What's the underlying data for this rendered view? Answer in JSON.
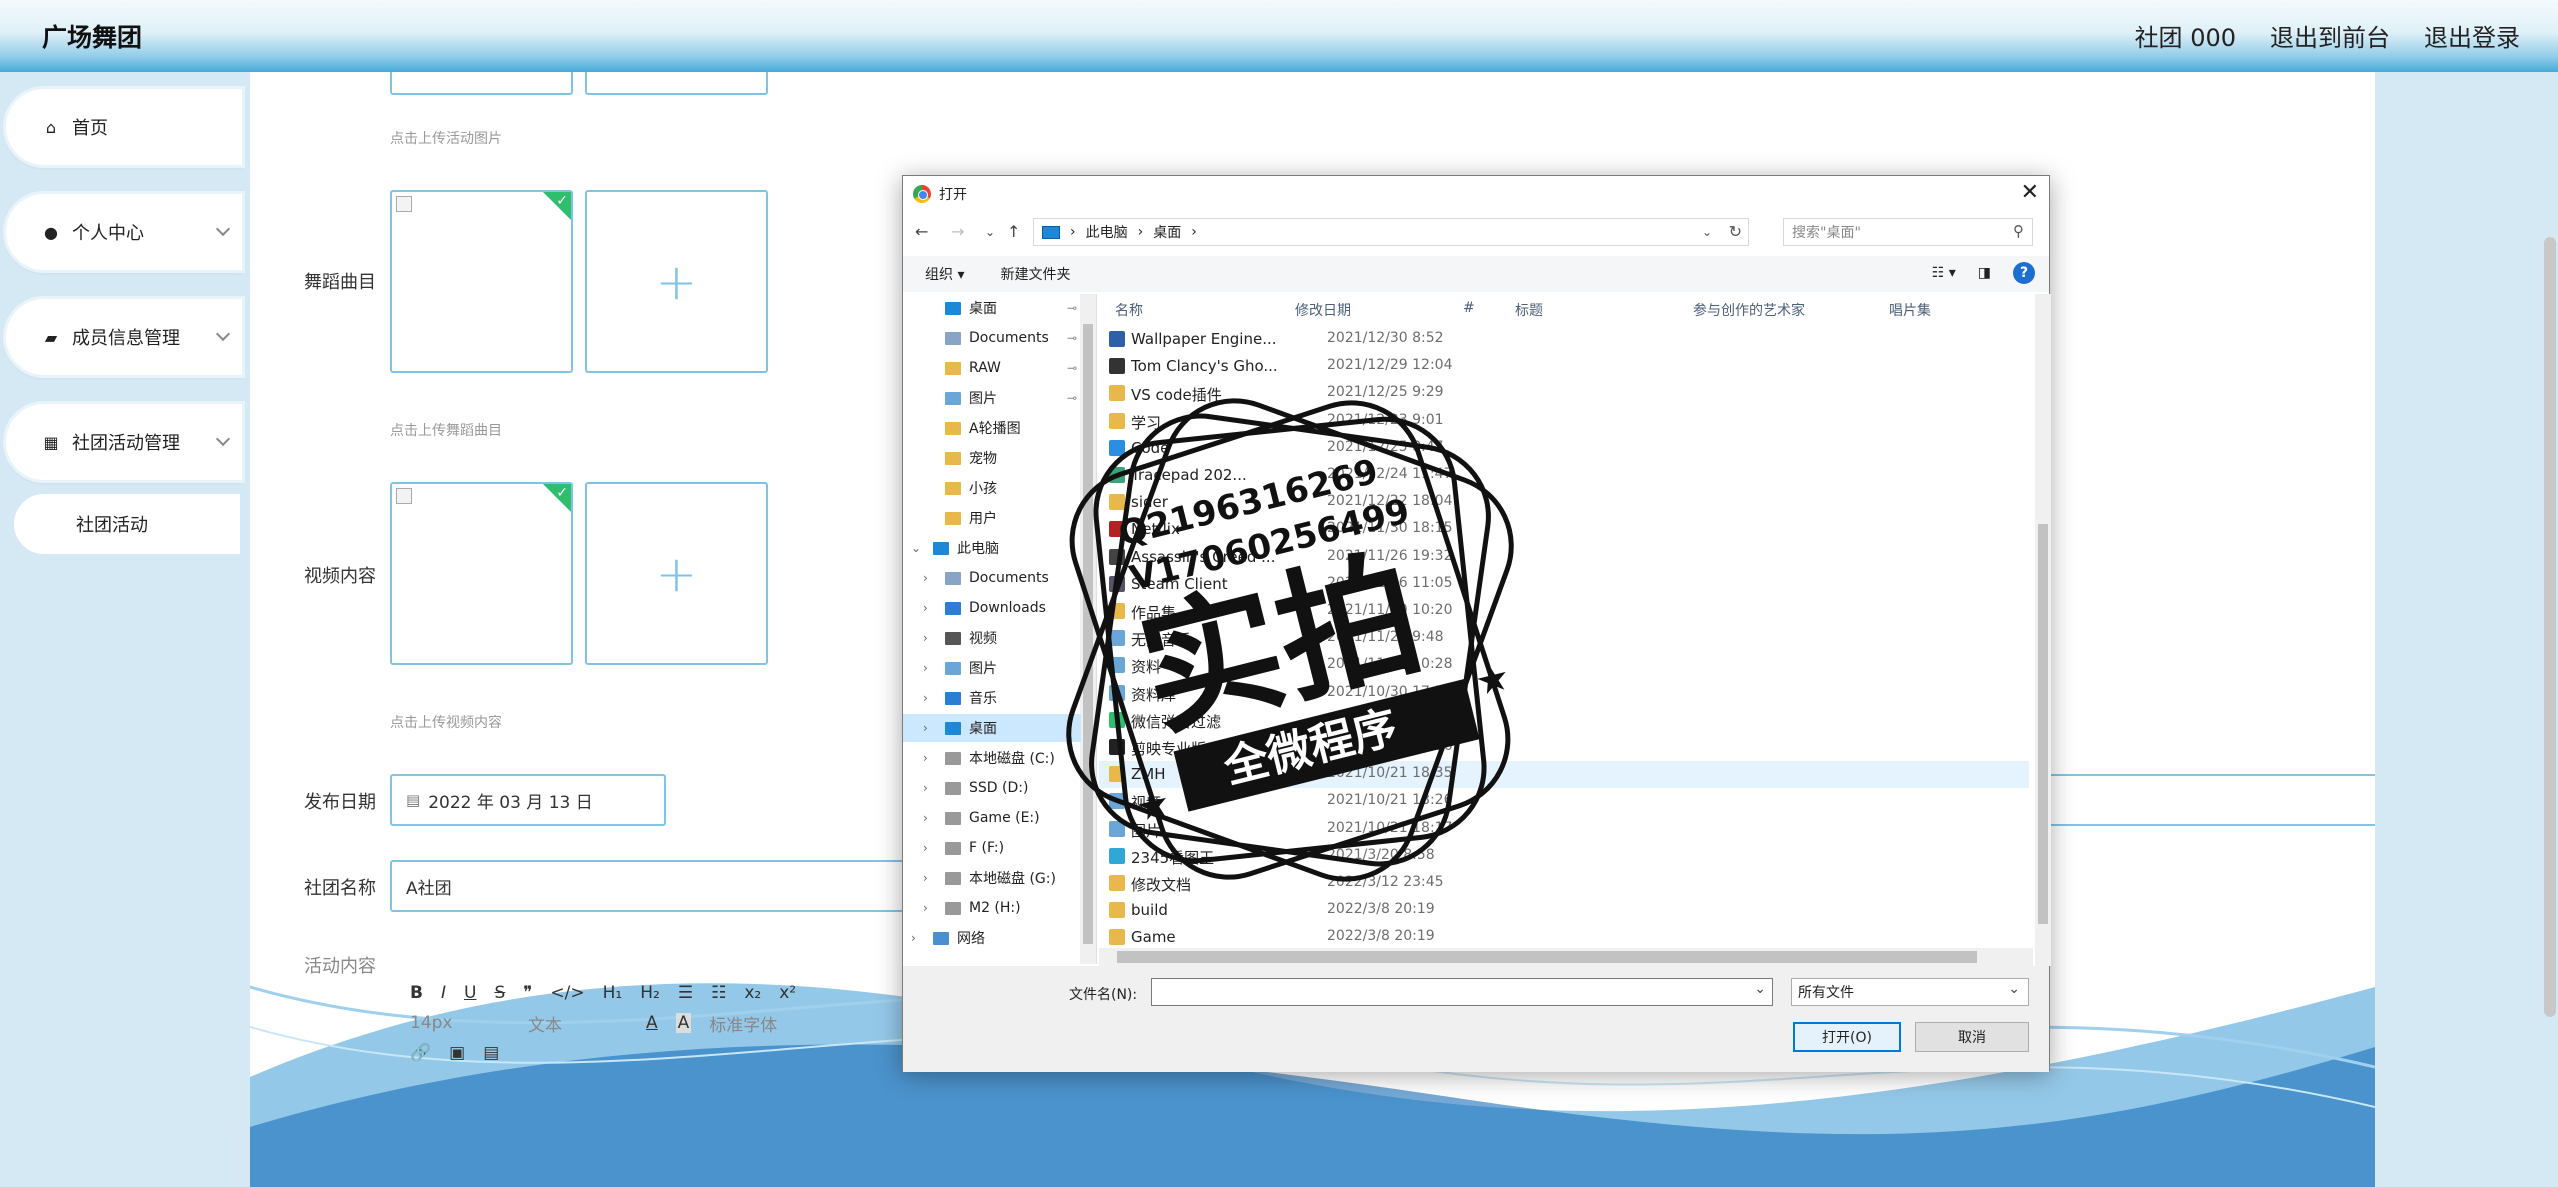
{
  "header": {
    "brand": "广场舞团",
    "nav": [
      "社团 000",
      "退出到前台",
      "退出登录"
    ]
  },
  "sidebar": {
    "items": [
      {
        "label": "首页",
        "icon": "home-icon"
      },
      {
        "label": "个人中心",
        "icon": "person-icon"
      },
      {
        "label": "成员信息管理",
        "icon": "wallet-icon"
      },
      {
        "label": "社团活动管理",
        "icon": "grid-icon"
      }
    ],
    "sub_item": "社团活动"
  },
  "form": {
    "hint_image": "点击上传活动图片",
    "music_label": "舞蹈曲目",
    "hint_music": "点击上传舞蹈曲目",
    "video_label": "视频内容",
    "hint_video": "点击上传视频内容",
    "date_label": "发布日期",
    "date_value": "2022 年 03 月 13 日",
    "club_label": "社团名称",
    "club_value": "A社团",
    "content_label": "活动内容",
    "toolbar_row1": [
      "B",
      "I",
      "U",
      "S",
      "❞",
      "</>",
      "H₁",
      "H₂",
      "☰",
      "☷",
      "x₂",
      "x²"
    ],
    "toolbar_row2": [
      "14px",
      "文本",
      "A",
      "A",
      "标准字体"
    ]
  },
  "dialog": {
    "title": "打开",
    "path": [
      "此电脑",
      "桌面"
    ],
    "search_placeholder": "搜索\"桌面\"",
    "cmd_organize": "组织 ▾",
    "cmd_newfolder": "新建文件夹",
    "columns": [
      "名称",
      "修改日期",
      "#",
      "标题",
      "参与创作的艺术家",
      "唱片集"
    ],
    "nav_items": [
      {
        "label": "桌面",
        "color": "#1e88d8",
        "pinned": true,
        "indent": 1,
        "selected": false
      },
      {
        "label": "Documents",
        "color": "#8aa4c8",
        "pinned": true,
        "indent": 1,
        "selected": false
      },
      {
        "label": "RAW",
        "color": "#e8b84a",
        "pinned": true,
        "indent": 1,
        "selected": false
      },
      {
        "label": "图片",
        "color": "#6aa6d8",
        "pinned": true,
        "indent": 1,
        "selected": false
      },
      {
        "label": "A轮播图",
        "color": "#e8b84a",
        "pinned": false,
        "indent": 1,
        "selected": false
      },
      {
        "label": "宠物",
        "color": "#e8b84a",
        "pinned": false,
        "indent": 1,
        "selected": false
      },
      {
        "label": "小孩",
        "color": "#e8b84a",
        "pinned": false,
        "indent": 1,
        "selected": false
      },
      {
        "label": "用户",
        "color": "#e8b84a",
        "pinned": false,
        "indent": 1,
        "selected": false
      },
      {
        "label": "此电脑",
        "color": "#1e88d8",
        "pinned": false,
        "indent": 0,
        "selected": false
      },
      {
        "label": "Documents",
        "color": "#8aa4c8",
        "pinned": false,
        "indent": 1,
        "selected": false
      },
      {
        "label": "Downloads",
        "color": "#2a7fd4",
        "pinned": false,
        "indent": 1,
        "selected": false
      },
      {
        "label": "视频",
        "color": "#555",
        "pinned": false,
        "indent": 1,
        "selected": false
      },
      {
        "label": "图片",
        "color": "#6aa6d8",
        "pinned": false,
        "indent": 1,
        "selected": false
      },
      {
        "label": "音乐",
        "color": "#2a7fd4",
        "pinned": false,
        "indent": 1,
        "selected": false
      },
      {
        "label": "桌面",
        "color": "#1e88d8",
        "pinned": false,
        "indent": 1,
        "selected": true
      },
      {
        "label": "本地磁盘 (C:)",
        "color": "#999",
        "pinned": false,
        "indent": 1,
        "selected": false
      },
      {
        "label": "SSD (D:)",
        "color": "#999",
        "pinned": false,
        "indent": 1,
        "selected": false
      },
      {
        "label": "Game (E:)",
        "color": "#999",
        "pinned": false,
        "indent": 1,
        "selected": false
      },
      {
        "label": "F (F:)",
        "color": "#999",
        "pinned": false,
        "indent": 1,
        "selected": false
      },
      {
        "label": "本地磁盘 (G:)",
        "color": "#999",
        "pinned": false,
        "indent": 1,
        "selected": false
      },
      {
        "label": "M2 (H:)",
        "color": "#999",
        "pinned": false,
        "indent": 1,
        "selected": false
      },
      {
        "label": "网络",
        "color": "#4a90d0",
        "pinned": false,
        "indent": 0,
        "selected": false
      }
    ],
    "files": [
      {
        "name": "Wallpaper Engine...",
        "date": "2021/12/30 8:52",
        "color": "#2e5fa8"
      },
      {
        "name": "Tom Clancy's Gho...",
        "date": "2021/12/29 12:04",
        "color": "#333"
      },
      {
        "name": "VS code插件",
        "date": "2021/12/25 9:29",
        "color": "#e8b84a"
      },
      {
        "name": "学习",
        "date": "2021/12/23 9:01",
        "color": "#e8b84a"
      },
      {
        "name": "Code",
        "date": "2021/12/25 8:47",
        "color": "#2a8fe0"
      },
      {
        "name": "Tracepad 202...",
        "date": "2021/12/24 11:47",
        "color": "#3aa57a"
      },
      {
        "name": "sider",
        "date": "2021/12/22 18:04",
        "color": "#e8b84a"
      },
      {
        "name": "Netflix",
        "date": "2021/11/30 18:15",
        "color": "#b22222"
      },
      {
        "name": "Assassin's Creed ...",
        "date": "2021/11/26 19:32",
        "color": "#444"
      },
      {
        "name": "Steam Client",
        "date": "2021/11/26 11:05",
        "color": "#556"
      },
      {
        "name": "作品集",
        "date": "2021/11/20 10:20",
        "color": "#e8b84a"
      },
      {
        "name": "无损音乐",
        "date": "2021/11/20 9:48",
        "color": "#6aa6d8"
      },
      {
        "name": "资料",
        "date": "2021/11/16 10:28",
        "color": "#6aa6d8"
      },
      {
        "name": "资料库",
        "date": "2021/10/30 17:54",
        "color": "#6aa6d8"
      },
      {
        "name": "微信弹窗过滤",
        "date": "2021/10/28 9:12",
        "color": "#2fbe6e"
      },
      {
        "name": "剪映专业版",
        "date": "2021/10/25 20:36",
        "color": "#222"
      },
      {
        "name": "ZMH",
        "date": "2021/10/21 18:35",
        "color": "#e8b84a"
      },
      {
        "name": "视频",
        "date": "2021/10/21 18:26",
        "color": "#6aa6d8"
      },
      {
        "name": "图片",
        "date": "2021/10/21 18:17",
        "color": "#6aa6d8"
      },
      {
        "name": "2345看图王",
        "date": "2021/3/20 8:58",
        "color": "#2fa8d8"
      },
      {
        "name": "修改文档",
        "date": "2022/3/12 23:45",
        "color": "#e8b84a"
      },
      {
        "name": "build",
        "date": "2022/3/8 20:19",
        "color": "#e8b84a"
      },
      {
        "name": "Game",
        "date": "2022/3/8 20:19",
        "color": "#e8b84a"
      }
    ],
    "highlighted_file_index": 16,
    "filename_label": "文件名(N):",
    "filetype": "所有文件",
    "open_button": "打开(O)",
    "cancel_button": "取消"
  },
  "stamp": {
    "line1": "Q2196316269",
    "line2": "V17060256499",
    "big": "实拍",
    "ribbon": "全微程序"
  },
  "colors": {
    "accent_border": "#7fc4e6",
    "success": "#2fbe6e",
    "dialog_select": "#cce8ff"
  }
}
